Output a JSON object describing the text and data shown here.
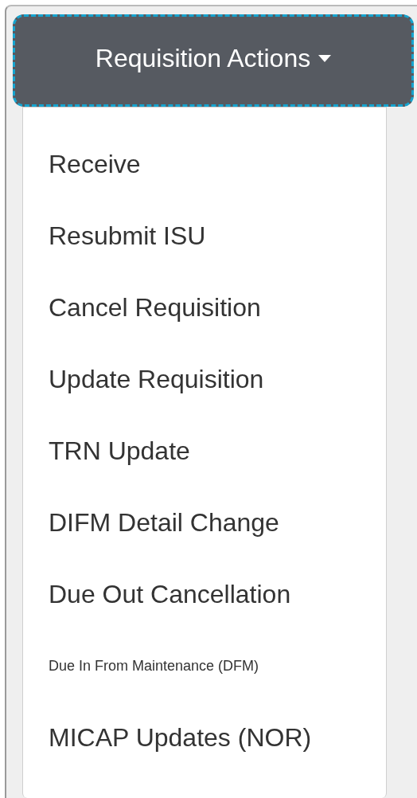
{
  "dropdown": {
    "label": "Requisition Actions",
    "expanded": true,
    "items": [
      {
        "label": "Receive",
        "kind": "normal"
      },
      {
        "label": "Resubmit ISU",
        "kind": "normal"
      },
      {
        "label": "Cancel Requisition",
        "kind": "normal"
      },
      {
        "label": "Update Requisition",
        "kind": "normal"
      },
      {
        "label": "TRN Update",
        "kind": "normal"
      },
      {
        "label": "DIFM Detail Change",
        "kind": "normal"
      },
      {
        "label": "Due Out Cancellation",
        "kind": "normal"
      },
      {
        "label": "Due In From Maintenance (DFM)",
        "kind": "small"
      },
      {
        "label": "MICAP Updates (NOR)",
        "kind": "normal"
      }
    ]
  }
}
